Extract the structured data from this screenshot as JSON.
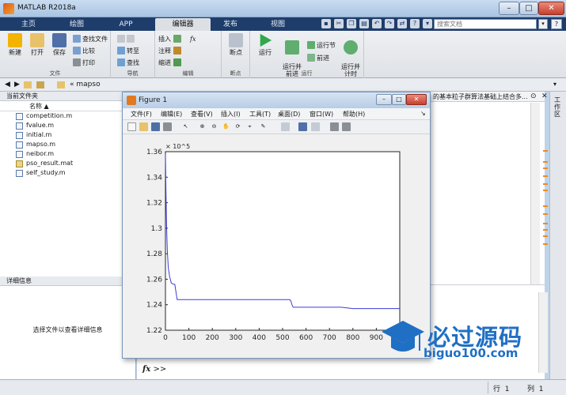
{
  "window": {
    "title": "MATLAB R2018a",
    "controls": {
      "minimize": "–",
      "maximize": "□",
      "close": "✕"
    }
  },
  "tabs": [
    {
      "label": "主页"
    },
    {
      "label": "绘图"
    },
    {
      "label": "APP"
    },
    {
      "label": "编辑器"
    },
    {
      "label": "发布"
    },
    {
      "label": "视图"
    }
  ],
  "search": {
    "placeholder": "搜索文档",
    "button": "▾",
    "help": "?"
  },
  "ribbon": {
    "file_group": {
      "label": "文件",
      "new": "新建",
      "open": "打开",
      "save": "保存",
      "find_files": "查找文件",
      "compare": "比较",
      "print": "打印"
    },
    "nav_group": {
      "label": "导航",
      "goto": "转至",
      "find": "查找"
    },
    "edit_group": {
      "label": "编辑",
      "insert": "插入",
      "comment": "注释",
      "indent": "缩进"
    },
    "breakpoint_group": {
      "label": "断点",
      "breakpoints": "断点"
    },
    "run_group": {
      "label": "运行",
      "run": "运行",
      "run_advance": "运行并\n前进",
      "run_section": "运行节",
      "advance": "前进",
      "run_time": "运行并\n计时"
    }
  },
  "address": {
    "path_prefix": "«",
    "folder": "mapso"
  },
  "current_folder": {
    "title": "当前文件夹",
    "column_name": "名称 ▲",
    "files": [
      {
        "name": "competition.m"
      },
      {
        "name": "fvalue.m"
      },
      {
        "name": "initial.m"
      },
      {
        "name": "mapso.m"
      },
      {
        "name": "neibor.m"
      },
      {
        "name": "pso_result.mat"
      },
      {
        "name": "self_study.m"
      }
    ]
  },
  "details": {
    "title": "详细信息",
    "message": "选择文件以查看详细信息"
  },
  "editor": {
    "tab_text": "的基本粒子群算法基础上结合多..."
  },
  "workspace": {
    "label": "工作区"
  },
  "command": {
    "fx": "fx",
    "prompt": ">>"
  },
  "status": {
    "row_label": "行",
    "row": "1",
    "col_label": "列",
    "col": "1"
  },
  "figure": {
    "title": "Figure 1",
    "menus": [
      "文件(F)",
      "编辑(E)",
      "查看(V)",
      "插入(I)",
      "工具(T)",
      "桌面(D)",
      "窗口(W)",
      "帮助(H)"
    ]
  },
  "chart_data": {
    "type": "line",
    "title": "",
    "xlabel": "",
    "ylabel": "",
    "y_exponent_label": "× 10^5",
    "xlim": [
      0,
      1000
    ],
    "ylim": [
      122000,
      136000
    ],
    "xticks": [
      0,
      100,
      200,
      300,
      400,
      500,
      600,
      700,
      800,
      900,
      1000
    ],
    "yticks": [
      1.22,
      1.24,
      1.26,
      1.28,
      1.3,
      1.32,
      1.34,
      1.36
    ],
    "grid": false,
    "color": "#3b3bd8",
    "series": [
      {
        "x": [
          0,
          2,
          5,
          8,
          12,
          18,
          25,
          35,
          40,
          45,
          50,
          55,
          520,
          530,
          535,
          540,
          545,
          550,
          560,
          570,
          580,
          600,
          650,
          700,
          750,
          800,
          850,
          900,
          1000
        ],
        "y": [
          135800,
          133000,
          130000,
          128200,
          126900,
          126200,
          125700,
          125600,
          125600,
          125000,
          124400,
          124400,
          124400,
          124400,
          124300,
          124000,
          123800,
          123800,
          123800,
          123800,
          123800,
          123800,
          123800,
          123800,
          123800,
          123700,
          123700,
          123700,
          123700
        ]
      }
    ]
  },
  "watermark": {
    "cn": "必过源码",
    "url": "biguo100.com"
  }
}
